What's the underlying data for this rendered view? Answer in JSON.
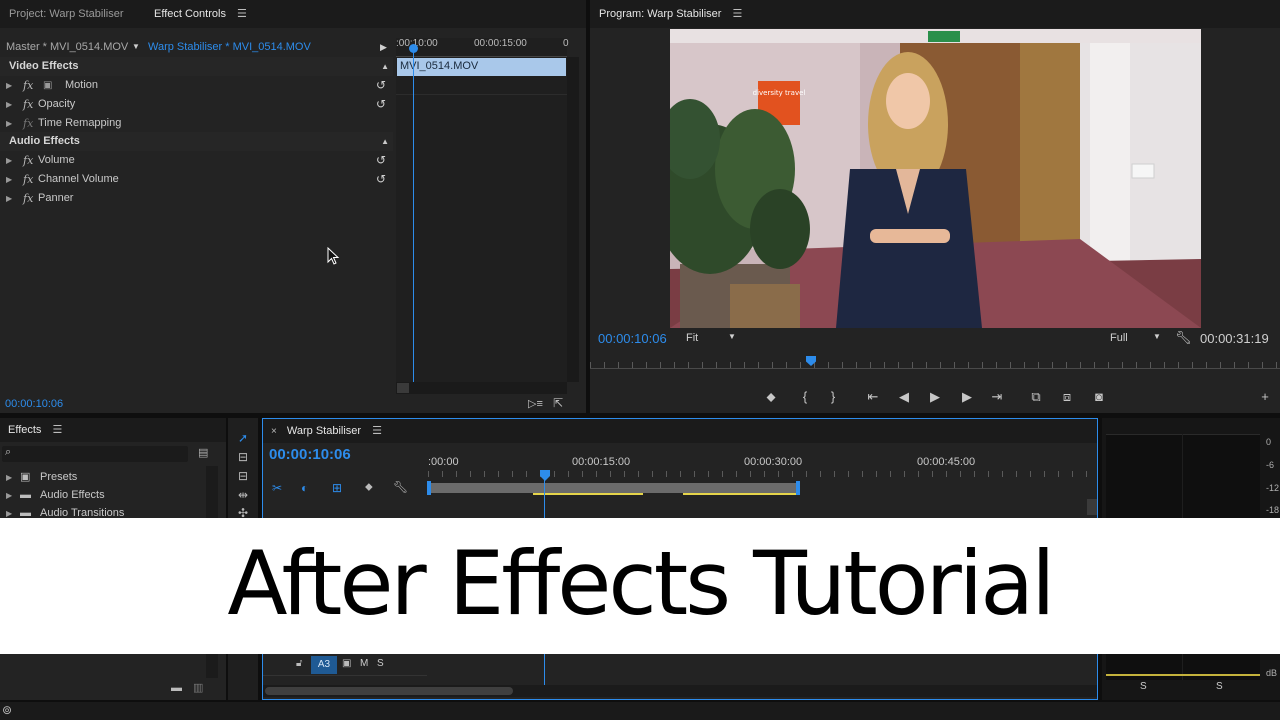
{
  "colors": {
    "accent": "#2d8ceb",
    "panel_bg": "#232323",
    "tab_bg": "#1b1b1b",
    "clip_bar": "#a9c8ea",
    "audio_marker": "#e5d44a"
  },
  "effect_controls_panel": {
    "tabs": [
      {
        "label": "Project: Warp Stabiliser",
        "active": false
      },
      {
        "label": "Effect Controls",
        "active": true
      }
    ],
    "master_label": "Master * MVI_0514.MOV",
    "clip_label": "Warp Stabiliser * MVI_0514.MOV",
    "ruler": {
      "start": ":00:10:00",
      "mid": "00:00:15:00",
      "end": "0"
    },
    "clip_name": "MVI_0514.MOV",
    "sections": [
      {
        "title": "Video Effects",
        "items": [
          {
            "label": "Motion",
            "has_reset": true
          },
          {
            "label": "Opacity",
            "has_reset": true
          },
          {
            "label": "Time Remapping",
            "has_reset": false
          }
        ]
      },
      {
        "title": "Audio Effects",
        "items": [
          {
            "label": "Volume",
            "has_reset": true
          },
          {
            "label": "Channel Volume",
            "has_reset": true
          },
          {
            "label": "Panner",
            "has_reset": false
          }
        ]
      }
    ],
    "timecode": "00:00:10:06"
  },
  "program_monitor": {
    "tab_label": "Program: Warp Stabiliser",
    "timecode_current": "00:00:10:06",
    "zoom_value": "Fit",
    "quality_value": "Full",
    "timecode_duration": "00:00:31:19",
    "scene_sign_text": "diversity travel"
  },
  "effects_panel": {
    "tab_label": "Effects",
    "search_placeholder": "",
    "items": [
      {
        "label": "Presets"
      },
      {
        "label": "Audio Effects"
      },
      {
        "label": "Audio Transitions"
      }
    ]
  },
  "timeline": {
    "sequence_tab": "Warp Stabiliser",
    "close_glyph": "×",
    "timecode": "00:00:10:06",
    "ruler_labels": [
      ":00:00",
      "00:00:15:00",
      "00:00:30:00",
      "00:00:45:00"
    ],
    "track_label": "A3",
    "track_m": "M",
    "track_s": "S",
    "playhead_fraction": 0.33
  },
  "audio_meter": {
    "scale": [
      "0",
      "-6",
      "-12",
      "-18",
      "dB"
    ],
    "solo_left": "S",
    "solo_right": "S"
  },
  "overlay_title": "After Effects Tutorial"
}
